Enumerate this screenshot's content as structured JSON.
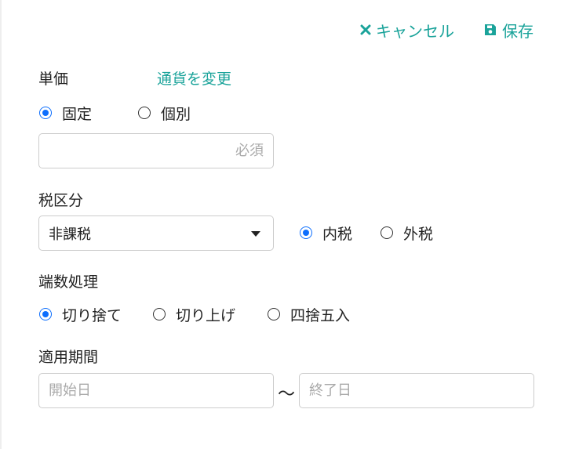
{
  "header": {
    "cancel_label": "キャンセル",
    "save_label": "保存"
  },
  "unit_price": {
    "label": "単価",
    "change_currency_link": "通貨を変更",
    "options": [
      {
        "label": "固定",
        "checked": true
      },
      {
        "label": "個別",
        "checked": false
      }
    ],
    "input": {
      "value": "",
      "placeholder": "必須"
    }
  },
  "tax": {
    "label": "税区分",
    "selected": "非課税",
    "options": [
      {
        "label": "内税",
        "checked": true
      },
      {
        "label": "外税",
        "checked": false
      }
    ]
  },
  "rounding": {
    "label": "端数処理",
    "options": [
      {
        "label": "切り捨て",
        "checked": true
      },
      {
        "label": "切り上げ",
        "checked": false
      },
      {
        "label": "四捨五入",
        "checked": false
      }
    ]
  },
  "period": {
    "label": "適用期間",
    "start_placeholder": "開始日",
    "separator": "〜",
    "end_placeholder": "終了日"
  },
  "colors": {
    "accent": "#1aa39a",
    "radio_checked": "#0d6efd"
  }
}
